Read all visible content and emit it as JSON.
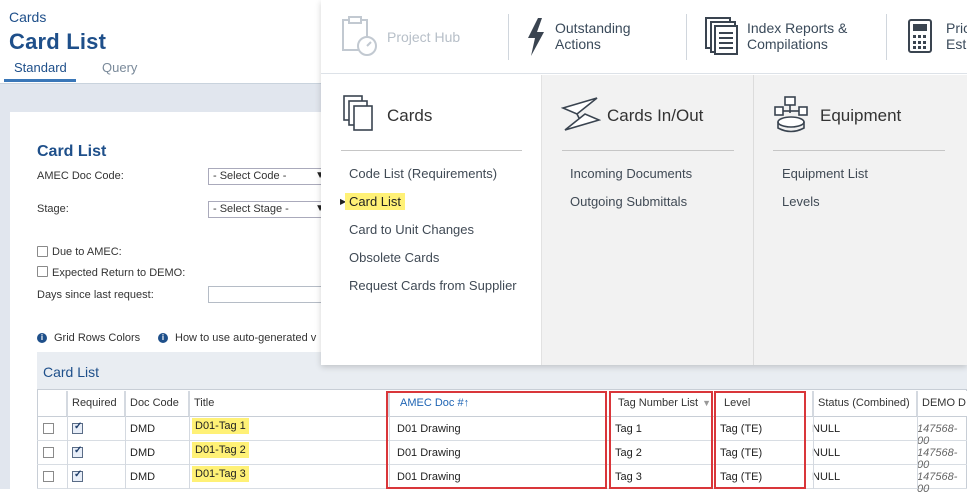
{
  "header": {
    "breadcrumb": "Cards",
    "title": "Card List",
    "tabs": [
      "Standard",
      "Query"
    ]
  },
  "form": {
    "title": "Card List",
    "doc_code_label": "AMEC Doc Code:",
    "doc_code_value": "- Select Code -",
    "stage_label": "Stage:",
    "stage_value": "- Select Stage -",
    "due_label": "Due to AMEC:",
    "expected_label": "Expected Return to DEMO:",
    "days_label": "Days since last request:"
  },
  "info": {
    "grid_colors": "Grid Rows Colors",
    "howto": "How to use auto-generated v"
  },
  "grid": {
    "title": "Card List",
    "columns": [
      "Required",
      "Doc Code",
      "Title",
      "AMEC Doc #↑",
      "Tag Number List",
      "Level",
      "Status (Combined)",
      "DEMO D"
    ],
    "rows": [
      {
        "checked": false,
        "required": true,
        "doc_code": "DMD",
        "title": "D01-Tag 1",
        "amec_doc": "D01 Drawing",
        "tag": "Tag 1",
        "level": "Tag (TE)",
        "status": "NULL",
        "demo": "147568-00"
      },
      {
        "checked": false,
        "required": true,
        "doc_code": "DMD",
        "title": "D01-Tag 2",
        "amec_doc": "D01 Drawing",
        "tag": "Tag 2",
        "level": "Tag (TE)",
        "status": "NULL",
        "demo": "147568-00"
      },
      {
        "checked": false,
        "required": true,
        "doc_code": "DMD",
        "title": "D01-Tag 3",
        "amec_doc": "D01 Drawing",
        "tag": "Tag 3",
        "level": "Tag (TE)",
        "status": "NULL",
        "demo": "147568-00"
      }
    ]
  },
  "menu": {
    "top": [
      {
        "label1": "Project Hub",
        "label2": "",
        "icon": "clipboard-gauge-icon",
        "disabled": true
      },
      {
        "label1": "Outstanding",
        "label2": "Actions",
        "icon": "lightning-icon",
        "disabled": false
      },
      {
        "label1": "Index Reports &",
        "label2": "Compilations",
        "icon": "report-stack-icon",
        "disabled": false
      },
      {
        "label1": "Pric",
        "label2": "Esti",
        "icon": "calculator-icon",
        "disabled": false
      }
    ],
    "cards": {
      "title": "Cards",
      "items": [
        "Code List (Requirements)",
        "Card List",
        "Card to Unit Changes",
        "Obsolete Cards",
        "Request Cards from Supplier"
      ],
      "active": "Card List"
    },
    "cards_inout": {
      "title": "Cards In/Out",
      "items": [
        "Incoming Documents",
        "Outgoing Submittals"
      ]
    },
    "equipment": {
      "title": "Equipment",
      "items": [
        "Equipment List",
        "Levels"
      ]
    }
  }
}
